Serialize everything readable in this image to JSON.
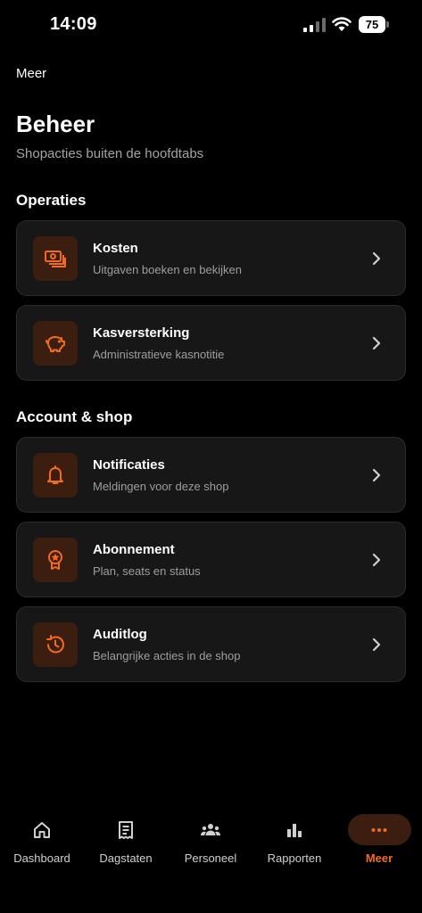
{
  "status_bar": {
    "time": "14:09",
    "battery": "75"
  },
  "header": {
    "nav_title": "Meer",
    "title": "Beheer",
    "subtitle": "Shopacties buiten de hoofdtabs"
  },
  "sections": [
    {
      "title": "Operaties",
      "items": [
        {
          "title": "Kosten",
          "subtitle": "Uitgaven boeken en bekijken",
          "icon": "money-icon"
        },
        {
          "title": "Kasversterking",
          "subtitle": "Administratieve kasnotitie",
          "icon": "piggy-bank-icon"
        }
      ]
    },
    {
      "title": "Account & shop",
      "items": [
        {
          "title": "Notificaties",
          "subtitle": "Meldingen voor deze shop",
          "icon": "bell-icon"
        },
        {
          "title": "Abonnement",
          "subtitle": "Plan, seats en status",
          "icon": "award-icon"
        },
        {
          "title": "Auditlog",
          "subtitle": "Belangrijke acties in de shop",
          "icon": "history-icon"
        }
      ]
    }
  ],
  "tabs": [
    {
      "label": "Dashboard",
      "icon": "home-icon"
    },
    {
      "label": "Dagstaten",
      "icon": "receipt-icon"
    },
    {
      "label": "Personeel",
      "icon": "people-icon"
    },
    {
      "label": "Rapporten",
      "icon": "bar-chart-icon"
    },
    {
      "label": "Meer",
      "icon": "more-icon",
      "active": true
    }
  ],
  "colors": {
    "accent": "#f26b1f",
    "card": "#171717",
    "icon_bg": "#3b1e10",
    "background": "#000000"
  }
}
